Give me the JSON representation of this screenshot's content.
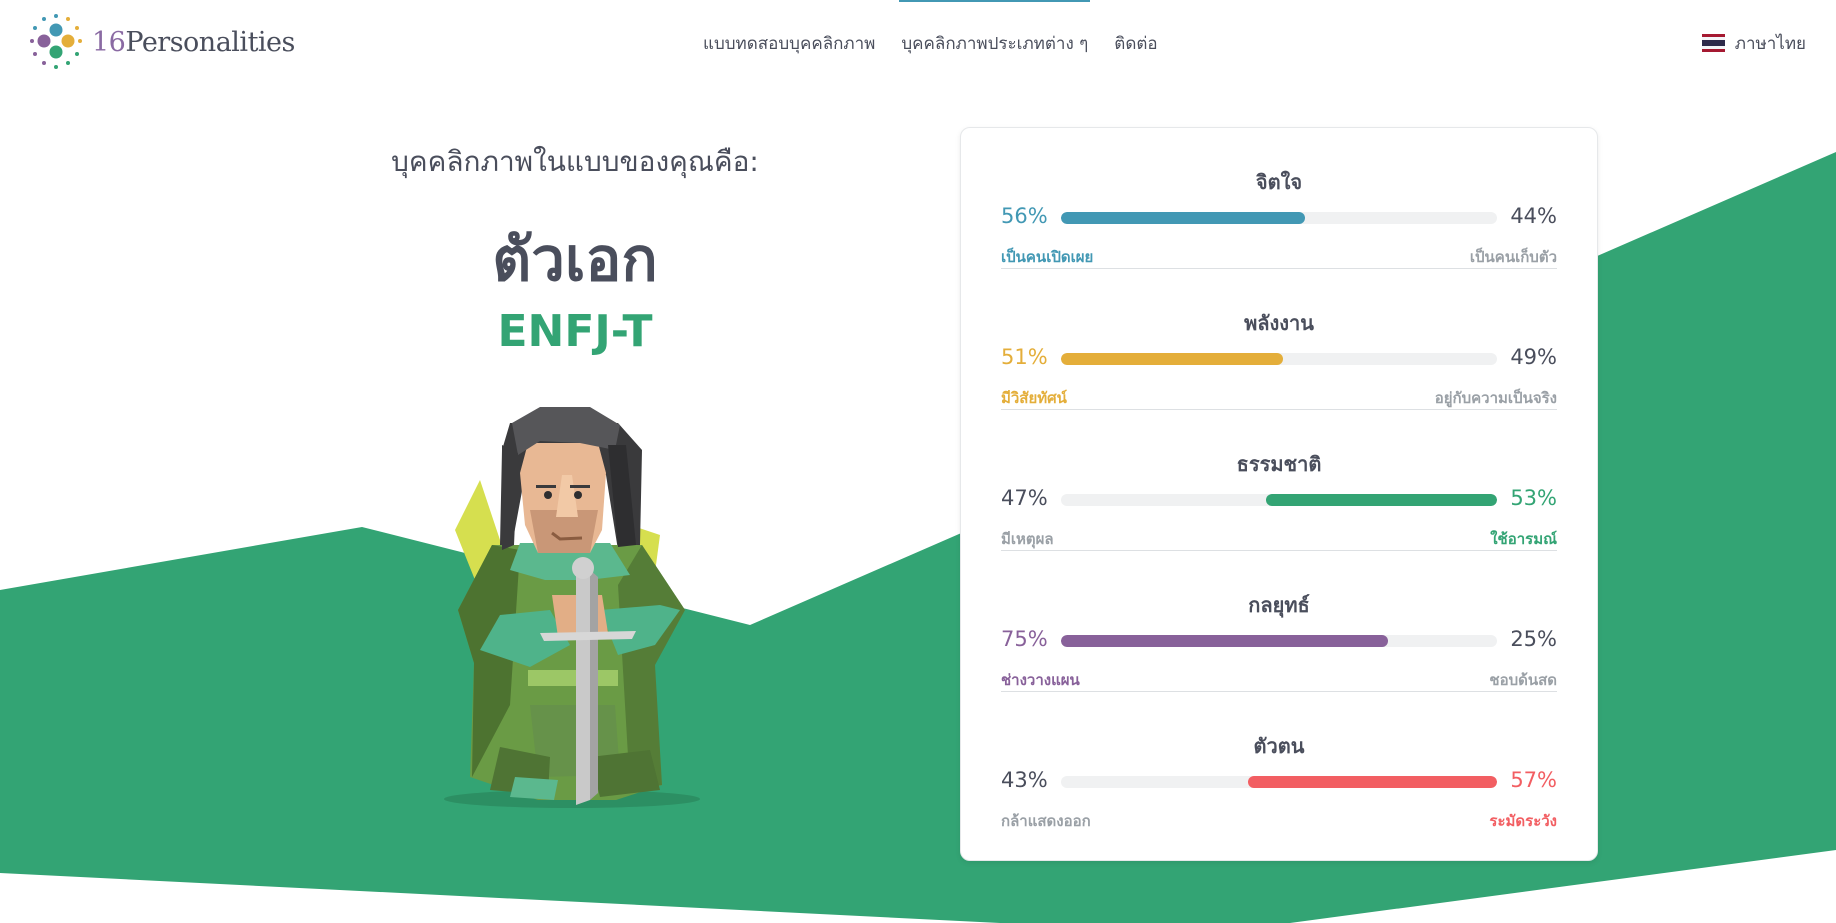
{
  "brand": {
    "logo_number": "16",
    "logo_word": "Personalities"
  },
  "nav": {
    "items": [
      {
        "label": "แบบทดสอบบุคคลิกภาพ",
        "active": false
      },
      {
        "label": "บุคคลิกภาพประเภทต่าง ๆ",
        "active": true
      },
      {
        "label": "ติดต่อ",
        "active": false
      }
    ],
    "language": "ภาษาไทย",
    "language_flag_icon": "thai-flag-icon"
  },
  "result": {
    "intro": "บุคคลิกภาพในแบบของคุณคือ:",
    "role": "ตัวเอก",
    "code": "ENFJ-T",
    "avatar_icon": "protagonist-knight-avatar"
  },
  "colors": {
    "accent_green": "#33a474",
    "blue": "#4298b4",
    "yellow": "#e4ae3a",
    "purple": "#88619a",
    "red": "#f25e62",
    "text": "#4a4e5c",
    "muted": "#9aa0a6"
  },
  "traits": [
    {
      "title": "จิตใจ",
      "left_pct": "56%",
      "right_pct": "44%",
      "left_label": "เป็นคนเปิดเผย",
      "right_label": "เป็นคนเก็บตัว",
      "dominant": "left",
      "value": 0.56,
      "color": "#4298b4"
    },
    {
      "title": "พลังงาน",
      "left_pct": "51%",
      "right_pct": "49%",
      "left_label": "มีวิสัยทัศน์",
      "right_label": "อยู่กับความเป็นจริง",
      "dominant": "left",
      "value": 0.51,
      "color": "#e4ae3a"
    },
    {
      "title": "ธรรมชาติ",
      "left_pct": "47%",
      "right_pct": "53%",
      "left_label": "มีเหตุผล",
      "right_label": "ใช้อารมณ์",
      "dominant": "right",
      "value": 0.53,
      "color": "#33a474"
    },
    {
      "title": "กลยุทธ์",
      "left_pct": "75%",
      "right_pct": "25%",
      "left_label": "ช่างวางแผน",
      "right_label": "ชอบด้นสด",
      "dominant": "left",
      "value": 0.75,
      "color": "#88619a"
    },
    {
      "title": "ตัวตน",
      "left_pct": "43%",
      "right_pct": "57%",
      "left_label": "กล้าแสดงออก",
      "right_label": "ระมัดระวัง",
      "dominant": "right",
      "value": 0.57,
      "color": "#f25e62"
    }
  ]
}
